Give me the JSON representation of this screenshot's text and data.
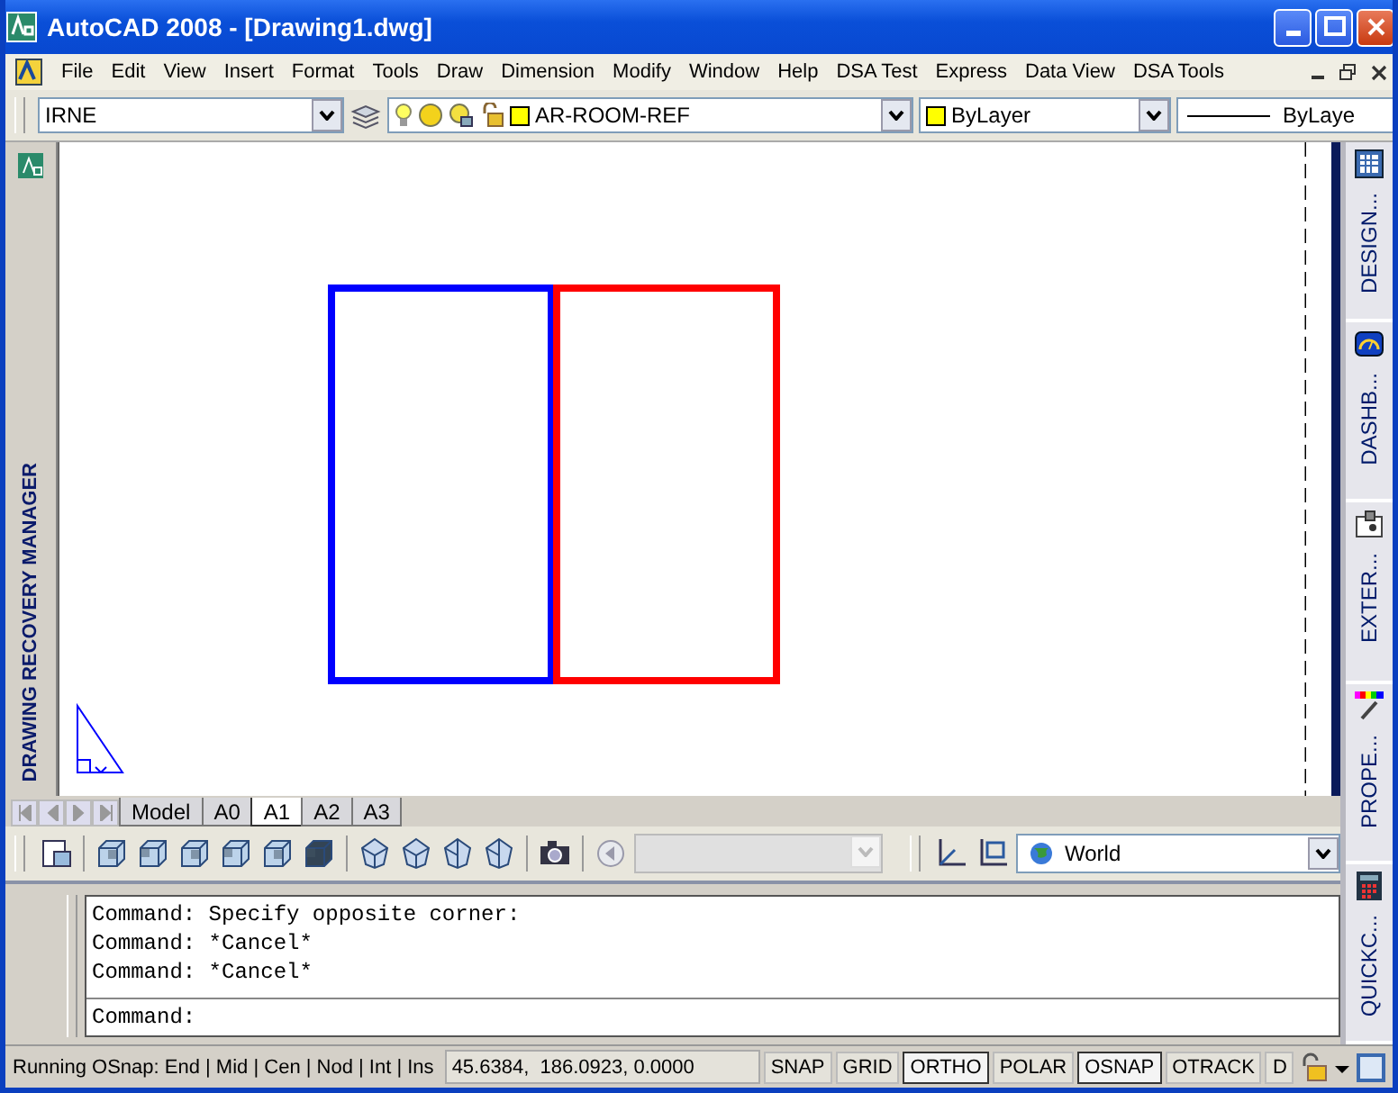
{
  "window": {
    "title": "AutoCAD 2008 - [Drawing1.dwg]"
  },
  "menu": [
    "File",
    "Edit",
    "View",
    "Insert",
    "Format",
    "Tools",
    "Draw",
    "Dimension",
    "Modify",
    "Window",
    "Help",
    "DSA Test",
    "Express",
    "Data View",
    "DSA Tools"
  ],
  "layers_toolbar": {
    "layer_state": "IRNE",
    "layer": "AR-ROOM-REF",
    "color_control": "ByLayer",
    "linetype": "ByLaye"
  },
  "left_palette": {
    "title": "DRAWING RECOVERY MANAGER"
  },
  "right_palette": {
    "tabs": [
      {
        "label": "DESIGN..."
      },
      {
        "label": "DASHB..."
      },
      {
        "label": "EXTER..."
      },
      {
        "label": "PROPE..."
      },
      {
        "label": "QUICKC..."
      }
    ]
  },
  "drawing": {
    "shapes": [
      {
        "kind": "rectangle",
        "color": "#0000ff"
      },
      {
        "kind": "rectangle",
        "color": "#ff0000"
      }
    ]
  },
  "layout_tabs": [
    {
      "label": "Model",
      "selected": false
    },
    {
      "label": "A0",
      "selected": false
    },
    {
      "label": "A1",
      "selected": true
    },
    {
      "label": "A2",
      "selected": false
    },
    {
      "label": "A3",
      "selected": false
    }
  ],
  "ucs": {
    "value": "World"
  },
  "command": {
    "history": [
      "Command: Specify opposite corner:",
      "Command: *Cancel*",
      "Command: *Cancel*"
    ],
    "prompt": "Command:"
  },
  "status_bar": {
    "osnap": "Running OSnap: End | Mid | Cen | Nod | Int | Ins",
    "coordinates": "45.6384,  186.0923, 0.0000",
    "toggles": [
      {
        "label": "SNAP",
        "on": false
      },
      {
        "label": "GRID",
        "on": false
      },
      {
        "label": "ORTHO",
        "on": true
      },
      {
        "label": "POLAR",
        "on": false
      },
      {
        "label": "OSNAP",
        "on": true
      },
      {
        "label": "OTRACK",
        "on": false
      },
      {
        "label": "D",
        "on": false
      }
    ]
  }
}
